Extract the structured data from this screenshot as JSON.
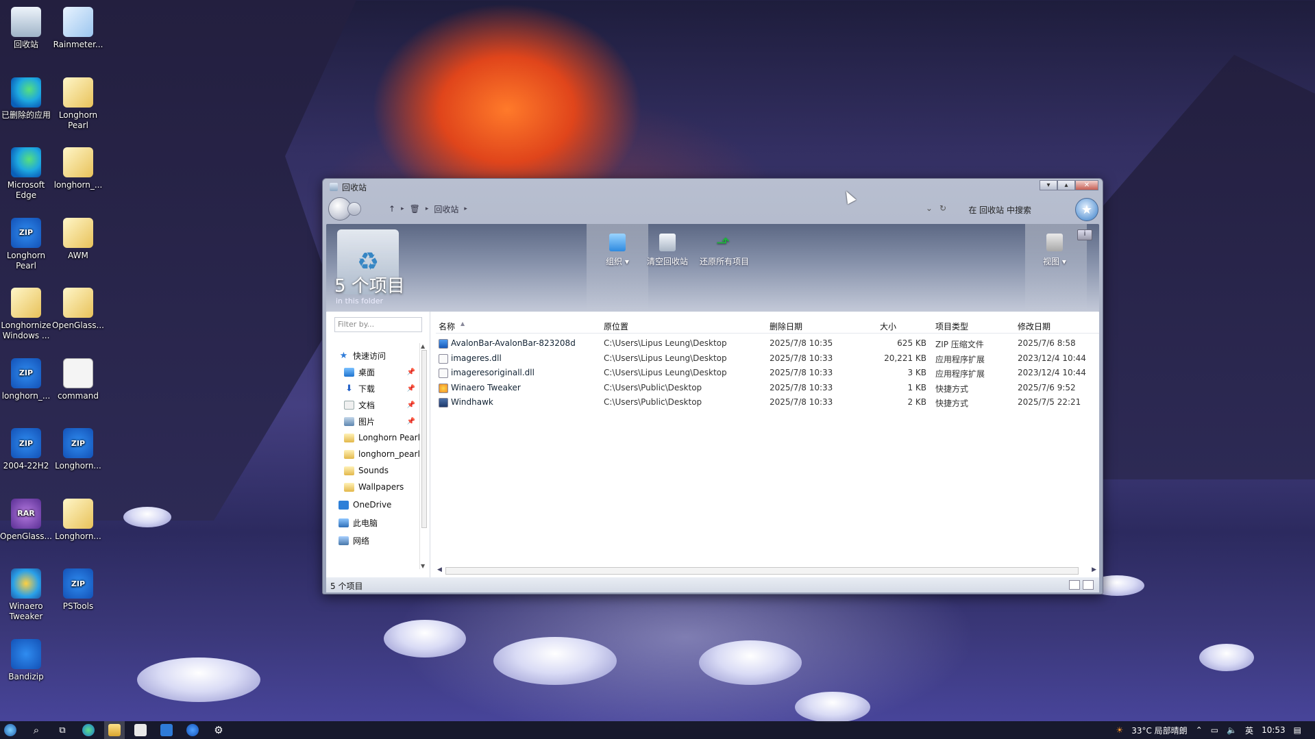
{
  "desktop_icons": [
    {
      "label": "回收站",
      "icon": "recycle-bin-icon"
    },
    {
      "label": "Rainmeter...",
      "icon": "rainmeter-icon"
    },
    {
      "label": "已删除的应用",
      "icon": "edge-icon"
    },
    {
      "label": "Longhorn Pearl",
      "icon": "folder-icon"
    },
    {
      "label": "Microsoft Edge",
      "icon": "edge-icon"
    },
    {
      "label": "longhorn_...",
      "icon": "folder-icon"
    },
    {
      "label": "Longhorn Pearl",
      "icon": "zip-icon",
      "badge": "ZIP"
    },
    {
      "label": "AWM",
      "icon": "folder-icon"
    },
    {
      "label": "Longhornize Windows ...",
      "icon": "folder-icon"
    },
    {
      "label": "OpenGlass...",
      "icon": "folder-icon"
    },
    {
      "label": "longhorn_...",
      "icon": "zip-icon",
      "badge": "ZIP"
    },
    {
      "label": "command",
      "icon": "document-icon"
    },
    {
      "label": "2004-22H2",
      "icon": "zip-icon",
      "badge": "ZIP"
    },
    {
      "label": "Longhorn...",
      "icon": "zip-icon",
      "badge": "ZIP"
    },
    {
      "label": "OpenGlass...",
      "icon": "rar-icon",
      "badge": "RAR"
    },
    {
      "label": "Longhorn...",
      "icon": "folder-icon"
    },
    {
      "label": "Winaero Tweaker",
      "icon": "winaero-icon"
    },
    {
      "label": "PSTools",
      "icon": "zip-icon",
      "badge": "ZIP"
    },
    {
      "label": "Bandizip",
      "icon": "bandizip-icon"
    }
  ],
  "window": {
    "title": "回收站",
    "breadcrumb": [
      "回收站"
    ],
    "search_label": "在 回收站 中搜索",
    "banner": {
      "count": "5 个项目",
      "subtitle": "in this folder"
    },
    "toolbar": {
      "organize": "组织 ▾",
      "empty": "清空回收站",
      "restore": "还原所有项目",
      "view": "视图 ▾"
    },
    "filter_placeholder": "Filter by...",
    "nav": [
      {
        "label": "快速访问",
        "icon": "star-icon",
        "indent": 0
      },
      {
        "label": "桌面",
        "icon": "desktop-icon",
        "indent": 1,
        "pinned": true
      },
      {
        "label": "下载",
        "icon": "download-icon",
        "indent": 1,
        "pinned": true
      },
      {
        "label": "文档",
        "icon": "documents-icon",
        "indent": 1,
        "pinned": true
      },
      {
        "label": "图片",
        "icon": "pictures-icon",
        "indent": 1,
        "pinned": true
      },
      {
        "label": "Longhorn Pearl",
        "icon": "folder-icon",
        "indent": 1
      },
      {
        "label": "longhorn_pearl",
        "icon": "folder-icon",
        "indent": 1
      },
      {
        "label": "Sounds",
        "icon": "folder-icon",
        "indent": 1
      },
      {
        "label": "Wallpapers",
        "icon": "folder-icon",
        "indent": 1
      },
      {
        "label": "OneDrive",
        "icon": "onedrive-icon",
        "indent": 0
      },
      {
        "label": "此电脑",
        "icon": "pc-icon",
        "indent": 0
      },
      {
        "label": "网络",
        "icon": "network-icon",
        "indent": 0
      }
    ],
    "columns": [
      "名称",
      "原位置",
      "删除日期",
      "大小",
      "项目类型",
      "修改日期"
    ],
    "files": [
      {
        "name": "AvalonBar-AvalonBar-823208d",
        "location": "C:\\Users\\Lipus Leung\\Desktop",
        "deleted": "2025/7/8 10:35",
        "size": "625 KB",
        "type": "ZIP 压缩文件",
        "modified": "2025/7/6 8:58",
        "icon": "zip"
      },
      {
        "name": "imageres.dll",
        "location": "C:\\Users\\Lipus Leung\\Desktop",
        "deleted": "2025/7/8 10:33",
        "size": "20,221 KB",
        "type": "应用程序扩展",
        "modified": "2023/12/4 10:44",
        "icon": "dll"
      },
      {
        "name": "imageresoriginall.dll",
        "location": "C:\\Users\\Lipus Leung\\Desktop",
        "deleted": "2025/7/8 10:33",
        "size": "3 KB",
        "type": "应用程序扩展",
        "modified": "2023/12/4 10:44",
        "icon": "dll"
      },
      {
        "name": "Winaero Tweaker",
        "location": "C:\\Users\\Public\\Desktop",
        "deleted": "2025/7/8 10:33",
        "size": "1 KB",
        "type": "快捷方式",
        "modified": "2025/7/6 9:52",
        "icon": "link"
      },
      {
        "name": "Windhawk",
        "location": "C:\\Users\\Public\\Desktop",
        "deleted": "2025/7/8 10:33",
        "size": "2 KB",
        "type": "快捷方式",
        "modified": "2025/7/5 22:21",
        "icon": "hawk"
      }
    ],
    "status": "5 个项目"
  },
  "taskbar": {
    "weather": "33°C 局部晴朗",
    "ime": "英",
    "time": "10:53"
  }
}
